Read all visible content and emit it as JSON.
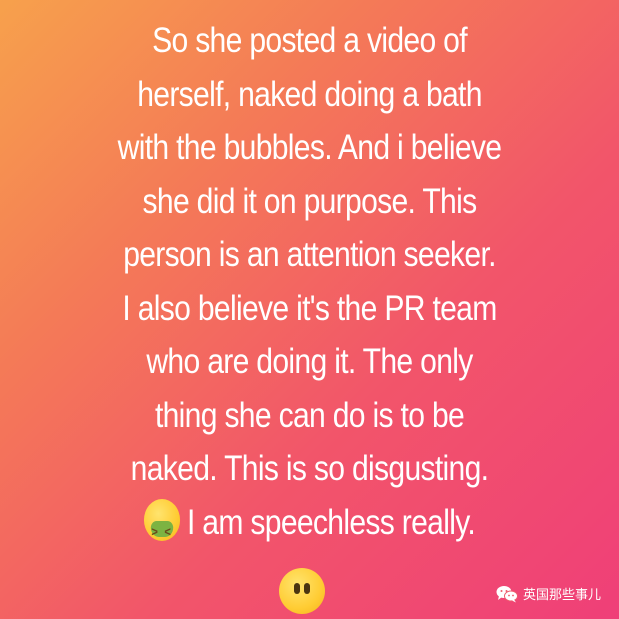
{
  "post": {
    "lines": [
      "So she posted a video of",
      "herself, naked doing a bath",
      "with the bubbles. And i believe",
      "she did it on purpose. This",
      "person is an attention seeker.",
      "I also believe it's the PR team",
      "who are doing it. The only",
      "thing she can do is to be",
      "naked. This is so disgusting.",
      "I am speechless really."
    ],
    "emojis": [
      "nauseated-face-icon",
      "face-without-mouth-icon"
    ]
  },
  "watermark": {
    "icon": "wechat-icon",
    "text": "英国那些事儿"
  },
  "colors": {
    "gradient_start": "#f7a14c",
    "gradient_end": "#ef3f78",
    "text": "#ffffff"
  }
}
